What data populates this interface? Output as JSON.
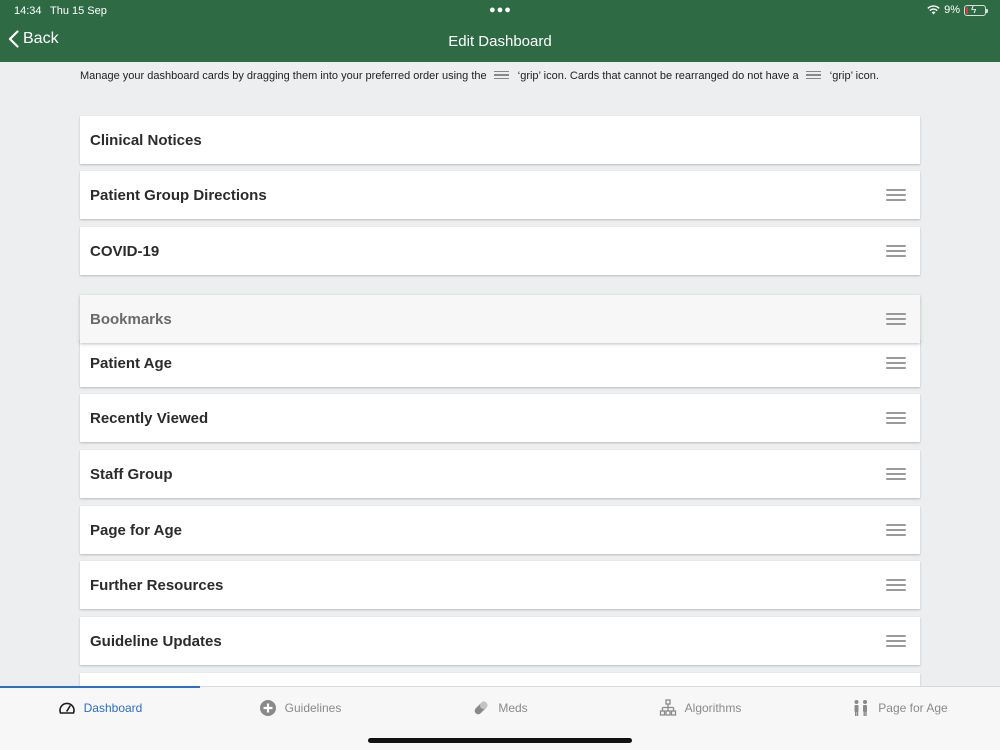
{
  "status_bar": {
    "time": "14:34",
    "date": "Thu 15 Sep",
    "battery": "9%"
  },
  "header": {
    "back_label": "Back",
    "title": "Edit Dashboard",
    "color": "#2e6b45"
  },
  "instructions": {
    "part1": "Manage your dashboard cards by dragging them into your preferred order using the",
    "part2": "‘grip’ icon. Cards that cannot be rearranged do not have a",
    "part3": "‘grip’",
    "part4": "icon."
  },
  "cards": [
    {
      "label": "Clinical Notices",
      "draggable": false
    },
    {
      "label": "Patient Group Directions",
      "draggable": true
    },
    {
      "label": "COVID-19",
      "draggable": true
    },
    {
      "label": "Bookmarks",
      "draggable": true
    },
    {
      "label": "Patient Age",
      "draggable": true
    },
    {
      "label": "Recently Viewed",
      "draggable": true
    },
    {
      "label": "Staff Group",
      "draggable": true
    },
    {
      "label": "Page for Age",
      "draggable": true
    },
    {
      "label": "Further Resources",
      "draggable": true
    },
    {
      "label": "Guideline Updates",
      "draggable": true
    }
  ],
  "tabs": [
    {
      "label": "Dashboard",
      "icon": "speedometer-icon",
      "active": true
    },
    {
      "label": "Guidelines",
      "icon": "plus-circle-icon",
      "active": false
    },
    {
      "label": "Meds",
      "icon": "pill-icon",
      "active": false
    },
    {
      "label": "Algorithms",
      "icon": "flowchart-icon",
      "active": false
    },
    {
      "label": "Page for Age",
      "icon": "people-icon",
      "active": false
    }
  ],
  "accent_color": "#2a6fc9"
}
